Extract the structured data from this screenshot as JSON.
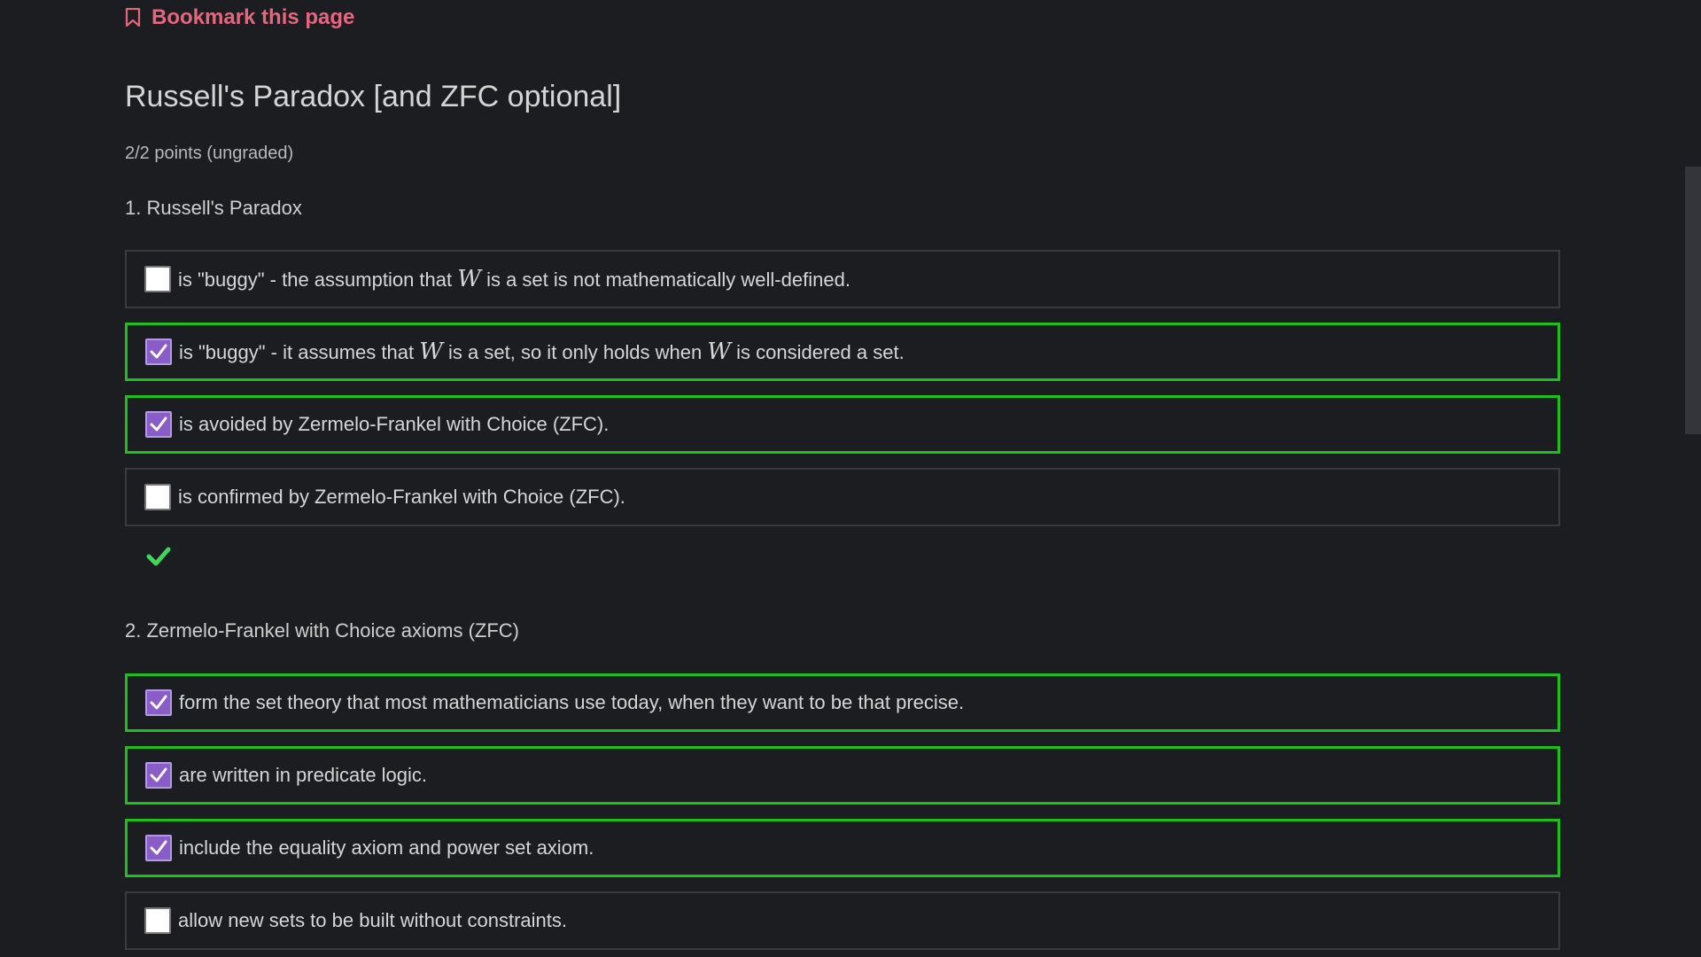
{
  "bookmark": {
    "label": "Bookmark this page",
    "icon": "bookmark-icon",
    "color": "#e5667f"
  },
  "title": "Russell's Paradox [and ZFC optional]",
  "points": "2/2 points (ungraded)",
  "colors": {
    "correct_border": "#1fbf1f",
    "checkbox_checked": "#8a5cc7",
    "background": "#1c1d20"
  },
  "questions": [
    {
      "label": "1. Russell's Paradox",
      "choices": [
        {
          "parts": [
            "is \"buggy\" - the assumption that ",
            "W",
            " is a set is not mathematically well-defined."
          ],
          "checked": false
        },
        {
          "parts": [
            "is \"buggy\" - it assumes that ",
            "W",
            " is a set, so it only holds when ",
            "W",
            " is considered a set."
          ],
          "checked": true
        },
        {
          "text": "is avoided by Zermelo-Frankel with Choice (ZFC).",
          "checked": true
        },
        {
          "text": "is confirmed by Zermelo-Frankel with Choice (ZFC).",
          "checked": false
        }
      ],
      "result_icon": "checkmark-icon"
    },
    {
      "label": "2. Zermelo-Frankel with Choice axioms (ZFC)",
      "choices": [
        {
          "text": "form the set theory that most mathematicians use today, when they want to be that precise.",
          "checked": true
        },
        {
          "text": "are written in predicate logic.",
          "checked": true
        },
        {
          "text": "include the equality axiom and power set axiom.",
          "checked": true
        },
        {
          "text": "allow new sets to be built without constraints.",
          "checked": false
        }
      ]
    }
  ]
}
